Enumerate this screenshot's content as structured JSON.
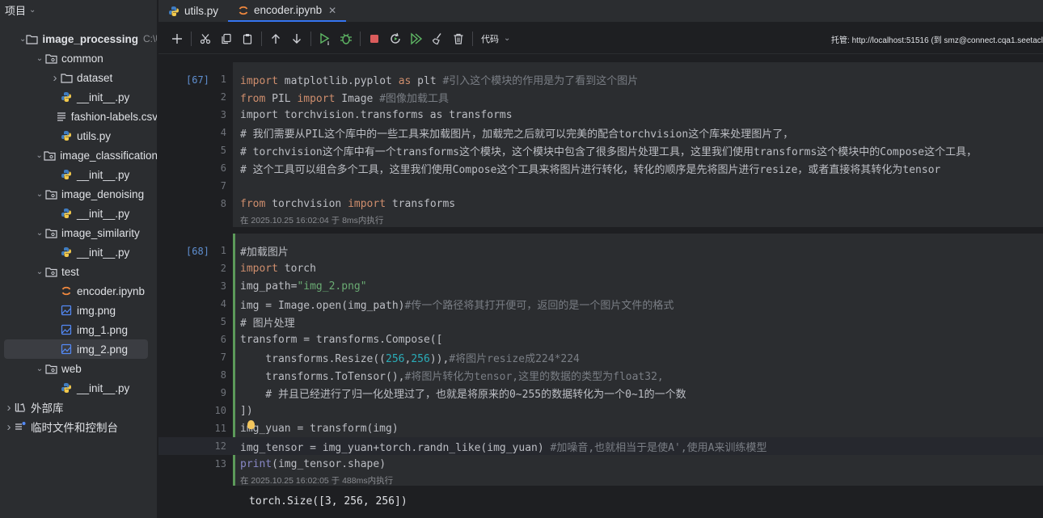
{
  "sidebar": {
    "title": "项目",
    "items": [
      {
        "label": "image_processing",
        "suffix": "C:\\U",
        "type": "folder",
        "expanded": true
      },
      {
        "label": "common",
        "type": "folder",
        "expanded": true
      },
      {
        "label": "dataset",
        "type": "folder",
        "expanded": false
      },
      {
        "label": "__init__.py",
        "type": "python"
      },
      {
        "label": "fashion-labels.csv",
        "type": "csv"
      },
      {
        "label": "utils.py",
        "type": "python"
      },
      {
        "label": "image_classification",
        "type": "folder",
        "expanded": true
      },
      {
        "label": "__init__.py",
        "type": "python"
      },
      {
        "label": "image_denoising",
        "type": "folder",
        "expanded": true
      },
      {
        "label": "__init__.py",
        "type": "python"
      },
      {
        "label": "image_similarity",
        "type": "folder",
        "expanded": true
      },
      {
        "label": "__init__.py",
        "type": "python"
      },
      {
        "label": "test",
        "type": "folder",
        "expanded": true
      },
      {
        "label": "encoder.ipynb",
        "type": "notebook"
      },
      {
        "label": "img.png",
        "type": "image"
      },
      {
        "label": "img_1.png",
        "type": "image"
      },
      {
        "label": "img_2.png",
        "type": "image",
        "selected": true
      },
      {
        "label": "web",
        "type": "folder",
        "expanded": true
      },
      {
        "label": "__init__.py",
        "type": "python"
      },
      {
        "label": "外部库",
        "type": "library",
        "expanded": false
      },
      {
        "label": "临时文件和控制台",
        "type": "scratch",
        "expanded": false
      }
    ]
  },
  "tabs": [
    {
      "label": "utils.py",
      "active": false
    },
    {
      "label": "encoder.ipynb",
      "active": true,
      "close": "✕"
    }
  ],
  "toolbar": {
    "kernel_label": "代码",
    "host_text": "托管: http://localhost:51516 (到 smz@connect.cqa1.seetacl"
  },
  "cells": [
    {
      "exec_count": "[67]",
      "lines": [
        "import matplotlib.pyplot as plt #引入这个模块的作用是为了看到这个图片",
        "from PIL import Image #图像加载工具",
        "import torchvision.transforms as transforms",
        "# 我们需要从PIL这个库中的一些工具来加载图片，加载完之后就可以完美的配合torchvision这个库来处理图片了，",
        "# torchvision这个库中有一个transforms这个模块，这个模块中包含了很多图片处理工具，这里我们使用transforms这个模块中的Compose这个工具，",
        "# 这个工具可以组合多个工具，这里我们使用Compose这个工具来将图片进行转化，转化的顺序是先将图片进行resize，或者直接将其转化为tensor",
        "",
        "from torchvision import transforms"
      ],
      "status": "在 2025.10.25 16:02:04 于 8ms内执行"
    },
    {
      "exec_count": "[68]",
      "lines": [
        "#加载图片",
        "import torch",
        "img_path=\"img_2.png\"",
        "img = Image.open(img_path)#传一个路径将其打开便可，返回的是一个图片文件的格式",
        "# 图片处理",
        "transform = transforms.Compose([",
        "    transforms.Resize((256,256)),#将图片resize成224*224",
        "    transforms.ToTensor(),#将图片转化为tensor,这里的数据的类型为float32,",
        "    # 并且已经进行了归一化处理过了，也就是将原来的0~255的数据转化为一个0~1的一个数",
        "])",
        "img_yuan = transform(img)",
        "img_tensor = img_yuan+torch.randn_like(img_yuan) #加噪音,也就相当于是使A',使用A来训练模型",
        "print(img_tensor.shape)"
      ],
      "status": "在 2025.10.25 16:02:05 于 488ms内执行",
      "output": "torch.Size([3, 256, 256])"
    }
  ],
  "colors": {
    "accent": "#3574f0",
    "keyword": "#cf8e6d",
    "comment": "#7a7e85",
    "string": "#6aab73",
    "number": "#2aacb8",
    "cell_bar": "#5c9a5a"
  }
}
